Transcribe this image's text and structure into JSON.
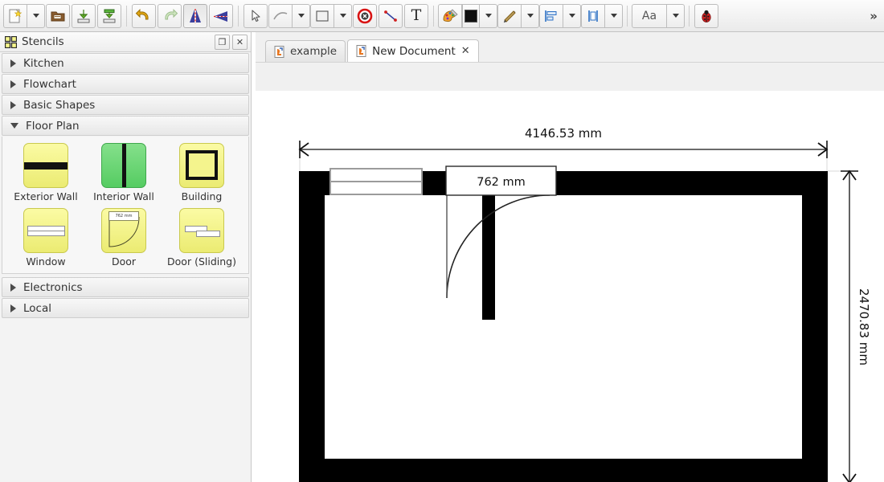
{
  "toolbar": {
    "items": [
      {
        "name": "new-document-button",
        "icon": "new-document-icon",
        "label": ""
      },
      {
        "name": "new-document-dropdown",
        "icon": "chevron-down-icon",
        "label": ""
      },
      {
        "name": "open-button",
        "icon": "open-folder-icon",
        "label": ""
      },
      {
        "name": "save-button",
        "icon": "save-icon",
        "label": ""
      },
      {
        "name": "save-as-button",
        "icon": "save-as-icon",
        "label": ""
      },
      {
        "name": "undo-button",
        "icon": "undo-arrow-icon",
        "label": ""
      },
      {
        "name": "redo-button",
        "icon": "redo-arrow-icon",
        "label": ""
      },
      {
        "name": "flip-horizontal-button",
        "icon": "flip-horizontal-icon",
        "label": ""
      },
      {
        "name": "flip-vertical-button",
        "icon": "flip-vertical-icon",
        "label": ""
      },
      {
        "name": "select-tool-button",
        "icon": "pointer-cursor-icon",
        "label": ""
      },
      {
        "name": "line-tool-button",
        "icon": "line-icon",
        "label": ""
      },
      {
        "name": "line-tool-dropdown",
        "icon": "chevron-down-icon",
        "label": ""
      },
      {
        "name": "rectangle-tool-button",
        "icon": "rectangle-icon",
        "label": ""
      },
      {
        "name": "rectangle-tool-dropdown",
        "icon": "chevron-down-icon",
        "label": ""
      },
      {
        "name": "delete-button",
        "icon": "delete-circle-icon",
        "label": ""
      },
      {
        "name": "connector-tool-button",
        "icon": "connector-icon",
        "label": ""
      },
      {
        "name": "text-tool-button",
        "icon": "text-t-icon",
        "label": "T"
      },
      {
        "name": "fill-color-button",
        "icon": "fill-palette-icon",
        "label": ""
      },
      {
        "name": "fill-color-swatch",
        "icon": "color-swatch-white-icon",
        "label": ""
      },
      {
        "name": "fill-color-dropdown",
        "icon": "chevron-down-icon",
        "label": ""
      },
      {
        "name": "line-color-button",
        "icon": "pencil-icon",
        "label": ""
      },
      {
        "name": "line-color-dropdown",
        "icon": "chevron-down-icon",
        "label": ""
      },
      {
        "name": "align-button",
        "icon": "align-left-icon",
        "label": ""
      },
      {
        "name": "align-dropdown",
        "icon": "chevron-down-icon",
        "label": ""
      },
      {
        "name": "distribute-button",
        "icon": "distribute-icon",
        "label": ""
      },
      {
        "name": "distribute-dropdown",
        "icon": "chevron-down-icon",
        "label": ""
      },
      {
        "name": "font-button",
        "icon": "font-aa-icon",
        "label": "Aa"
      },
      {
        "name": "font-dropdown",
        "icon": "chevron-down-icon",
        "label": ""
      },
      {
        "name": "debug-button",
        "icon": "ladybug-icon",
        "label": ""
      }
    ],
    "font_label": "Aa",
    "text_label": "T",
    "overflow_label": "»"
  },
  "sidebar": {
    "panel_title": "Stencils",
    "panel_icon": "stencils-grid-icon",
    "float_button_label": "❐",
    "close_button_label": "✕",
    "groups": [
      {
        "label": "Kitchen",
        "expanded": false
      },
      {
        "label": "Flowchart",
        "expanded": false
      },
      {
        "label": "Basic Shapes",
        "expanded": false
      },
      {
        "label": "Floor Plan",
        "expanded": true
      }
    ],
    "stencils": [
      {
        "label": "Exterior Wall",
        "icon": "exterior-wall-stencil"
      },
      {
        "label": "Interior Wall",
        "icon": "interior-wall-stencil"
      },
      {
        "label": "Building",
        "icon": "building-stencil"
      },
      {
        "label": "Window",
        "icon": "window-stencil"
      },
      {
        "label": "Door",
        "icon": "door-stencil"
      },
      {
        "label": "Door (Sliding)",
        "icon": "sliding-door-stencil"
      }
    ],
    "door_thumb_label": "762 mm",
    "groups_after": [
      {
        "label": "Electronics",
        "expanded": false
      },
      {
        "label": "Local",
        "expanded": false
      }
    ]
  },
  "tabs": [
    {
      "label": "example",
      "active": false,
      "closable": false,
      "icon": "document-icon"
    },
    {
      "label": "New Document",
      "active": true,
      "closable": true,
      "icon": "document-icon",
      "close_label": "✕"
    }
  ],
  "canvas": {
    "width_dimension": "4146.53 mm",
    "height_dimension": "2470.83 mm",
    "door_dimension": "762 mm"
  },
  "colors": {
    "wall": "#000000",
    "stencil_yellow": "#f2f283",
    "stencil_green": "#64d470",
    "toolbar_bg": "#f2f2f2",
    "canvas_bg": "#ffffff",
    "panel_bg": "#f3f3f3"
  }
}
